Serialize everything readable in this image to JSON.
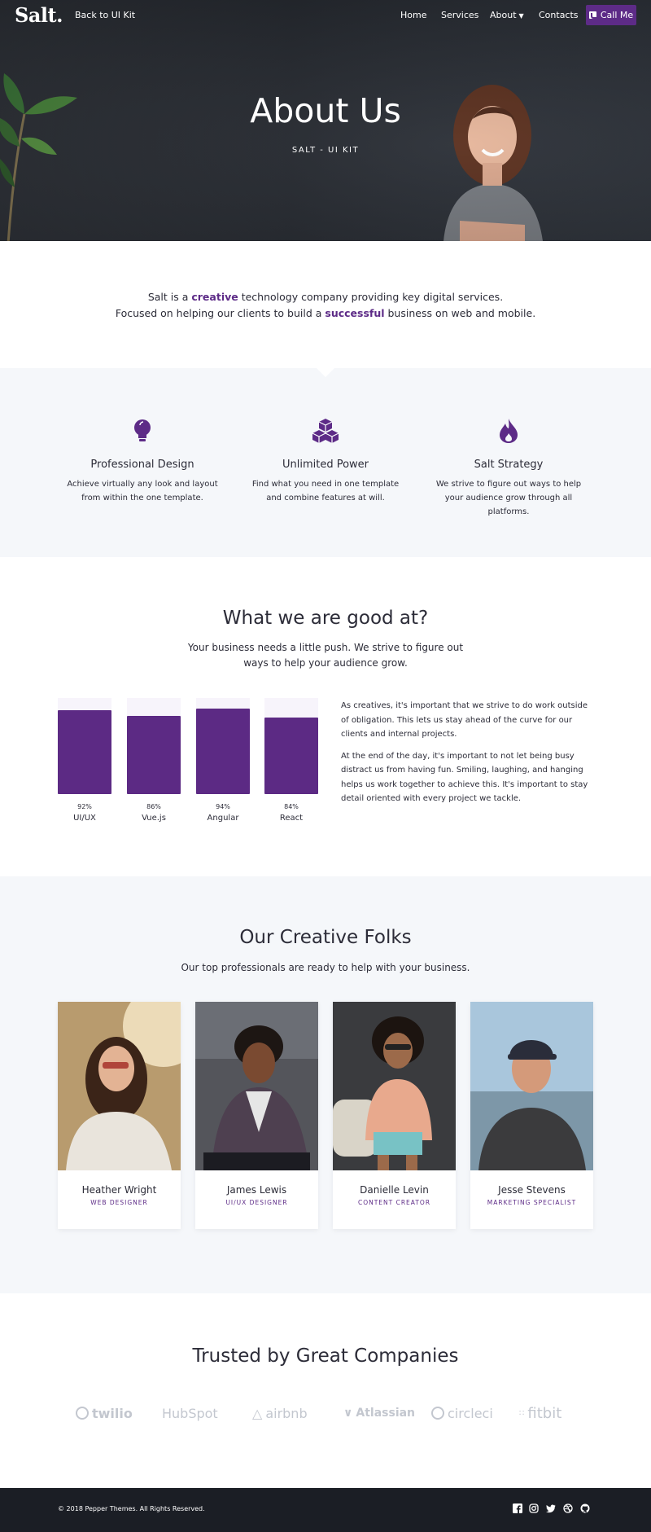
{
  "header": {
    "logo": "Salt.",
    "back_link": "Back to UI Kit",
    "nav": [
      "Home",
      "Services",
      "About",
      "Contacts"
    ],
    "cta": "Call Me"
  },
  "hero": {
    "title": "About Us",
    "subtitle": "SALT - UI KIT"
  },
  "intro": {
    "line1_pre": "Salt is a ",
    "line1_em": "creative",
    "line1_post": " technology company providing key digital services.",
    "line2_pre": "Focused on helping our clients to build a ",
    "line2_em": "successful",
    "line2_post": " business on web and mobile."
  },
  "features": [
    {
      "icon": "lightbulb-icon",
      "title": "Professional Design",
      "text": "Achieve virtually any look and layout from within the one template."
    },
    {
      "icon": "cubes-icon",
      "title": "Unlimited Power",
      "text": "Find what you need in one template and combine features at will."
    },
    {
      "icon": "fire-icon",
      "title": "Salt Strategy",
      "text": "We strive to figure out ways to help your audience grow through all platforms."
    }
  ],
  "skills": {
    "title": "What we are good at?",
    "subtitle": "Your business needs a little push. We strive to figure out ways to help your audience grow.",
    "items": [
      {
        "label": "UI/UX",
        "value": 92,
        "pct": "92%"
      },
      {
        "label": "Vue.js",
        "value": 86,
        "pct": "86%"
      },
      {
        "label": "Angular",
        "value": 94,
        "pct": "94%"
      },
      {
        "label": "React",
        "value": 84,
        "pct": "84%"
      }
    ],
    "paragraph1": "As creatives, it's important that we strive to do work outside of obligation. This lets us stay ahead of the curve for our clients and internal projects.",
    "paragraph2": "At the end of the day, it's important to not let being busy distract us from having fun. Smiling, laughing, and hanging helps us work together to achieve this. It's important to stay detail oriented with every project we tackle."
  },
  "team": {
    "title": "Our Creative Folks",
    "subtitle": "Our top professionals are ready to help with your business.",
    "members": [
      {
        "name": "Heather Wright",
        "role": "WEB DESIGNER"
      },
      {
        "name": "James Lewis",
        "role": "UI/UX DESIGNER"
      },
      {
        "name": "Danielle Levin",
        "role": "CONTENT CREATOR"
      },
      {
        "name": "Jesse Stevens",
        "role": "MARKETING SPECIALIST"
      }
    ]
  },
  "companies": {
    "title": "Trusted by Great Companies",
    "logos": [
      "twilio",
      "HubSpot",
      "airbnb",
      "Atlassian",
      "circleci",
      "fitbit"
    ]
  },
  "footer": {
    "copyright": "© 2018 Pepper Themes. All Rights Reserved.",
    "social": [
      "facebook-icon",
      "instagram-icon",
      "twitter-icon",
      "dribbble-icon",
      "github-icon"
    ]
  },
  "colors": {
    "accent": "#5d2b87",
    "dark": "#1b1e25",
    "light_bg": "#f5f7fa"
  }
}
